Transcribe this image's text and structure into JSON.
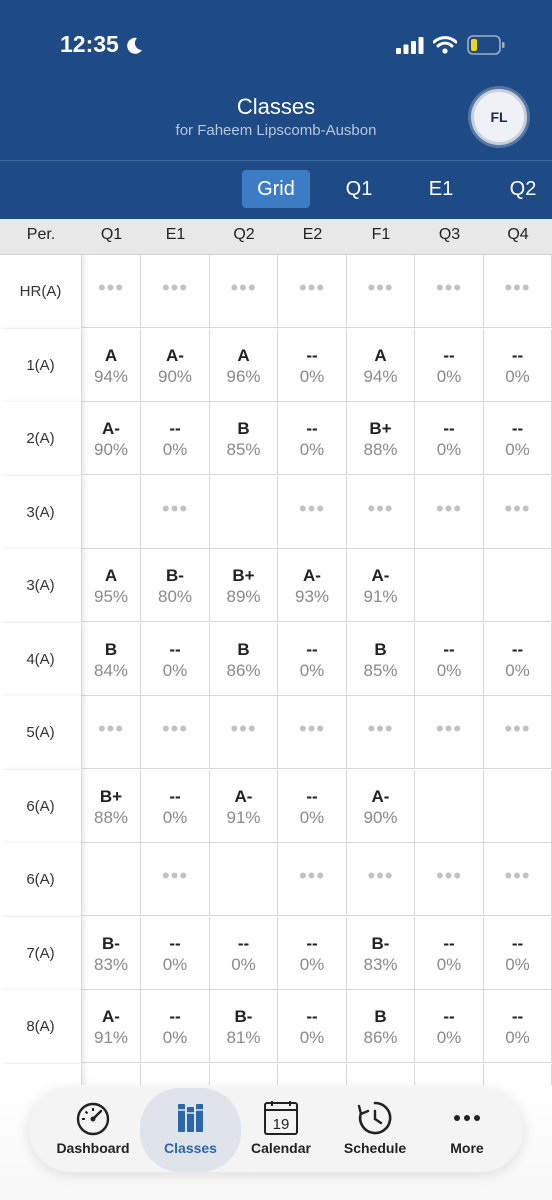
{
  "status_bar": {
    "time": "12:35"
  },
  "header": {
    "title": "Classes",
    "subtitle": "for Faheem Lipscomb-Ausbon",
    "avatar_initials": "FL"
  },
  "tabs": [
    {
      "label": "Grid",
      "active": true
    },
    {
      "label": "Q1",
      "active": false
    },
    {
      "label": "E1",
      "active": false
    },
    {
      "label": "Q2",
      "active": false
    }
  ],
  "columns": [
    "Per.",
    "Q1",
    "E1",
    "Q2",
    "E2",
    "F1",
    "Q3",
    "Q4"
  ],
  "rows": [
    {
      "period": "HR(A)",
      "cells": [
        "dots",
        "dots",
        "dots",
        "dots",
        "dots",
        "dots",
        "dots"
      ]
    },
    {
      "period": "1(A)",
      "cells": [
        [
          "A",
          "94%"
        ],
        [
          "A-",
          "90%"
        ],
        [
          "A",
          "96%"
        ],
        [
          "--",
          "0%"
        ],
        [
          "A",
          "94%"
        ],
        [
          "--",
          "0%"
        ],
        [
          "--",
          "0%"
        ]
      ]
    },
    {
      "period": "2(A)",
      "cells": [
        [
          "A-",
          "90%"
        ],
        [
          "--",
          "0%"
        ],
        [
          "B",
          "85%"
        ],
        [
          "--",
          "0%"
        ],
        [
          "B+",
          "88%"
        ],
        [
          "--",
          "0%"
        ],
        [
          "--",
          "0%"
        ]
      ]
    },
    {
      "period": "3(A)",
      "cells": [
        "empty",
        "dots",
        "empty",
        "dots",
        "dots",
        "dots",
        "dots"
      ]
    },
    {
      "period": "3(A)",
      "cells": [
        [
          "A",
          "95%"
        ],
        [
          "B-",
          "80%"
        ],
        [
          "B+",
          "89%"
        ],
        [
          "A-",
          "93%"
        ],
        [
          "A-",
          "91%"
        ],
        "empty",
        "empty"
      ]
    },
    {
      "period": "4(A)",
      "cells": [
        [
          "B",
          "84%"
        ],
        [
          "--",
          "0%"
        ],
        [
          "B",
          "86%"
        ],
        [
          "--",
          "0%"
        ],
        [
          "B",
          "85%"
        ],
        [
          "--",
          "0%"
        ],
        [
          "--",
          "0%"
        ]
      ]
    },
    {
      "period": "5(A)",
      "cells": [
        "dots",
        "dots",
        "dots",
        "dots",
        "dots",
        "dots",
        "dots"
      ]
    },
    {
      "period": "6(A)",
      "cells": [
        [
          "B+",
          "88%"
        ],
        [
          "--",
          "0%"
        ],
        [
          "A-",
          "91%"
        ],
        [
          "--",
          "0%"
        ],
        [
          "A-",
          "90%"
        ],
        "empty",
        "empty"
      ]
    },
    {
      "period": "6(A)",
      "cells": [
        "empty",
        "dots",
        "empty",
        "dots",
        "dots",
        "dots",
        "dots"
      ]
    },
    {
      "period": "7(A)",
      "cells": [
        [
          "B-",
          "83%"
        ],
        [
          "--",
          "0%"
        ],
        [
          "--",
          "0%"
        ],
        [
          "--",
          "0%"
        ],
        [
          "B-",
          "83%"
        ],
        [
          "--",
          "0%"
        ],
        [
          "--",
          "0%"
        ]
      ]
    },
    {
      "period": "8(A)",
      "cells": [
        [
          "A-",
          "91%"
        ],
        [
          "--",
          "0%"
        ],
        [
          "B-",
          "81%"
        ],
        [
          "--",
          "0%"
        ],
        [
          "B",
          "86%"
        ],
        [
          "--",
          "0%"
        ],
        [
          "--",
          "0%"
        ]
      ]
    },
    {
      "period": "",
      "cells": [
        "empty",
        "empty",
        "empty",
        "empty",
        "empty",
        "empty",
        "empty"
      ]
    }
  ],
  "dots_glyph": "•••",
  "bottom_nav": [
    {
      "label": "Dashboard",
      "icon": "gauge-icon",
      "active": false
    },
    {
      "label": "Classes",
      "icon": "books-icon",
      "active": true
    },
    {
      "label": "Calendar",
      "icon": "calendar-icon",
      "active": false,
      "day": "19"
    },
    {
      "label": "Schedule",
      "icon": "clock-icon",
      "active": false
    },
    {
      "label": "More",
      "icon": "more-icon",
      "active": false
    }
  ],
  "colors": {
    "header": "#1e4a85",
    "active_tab": "#3b7cc4",
    "accent": "#2e66ac"
  }
}
